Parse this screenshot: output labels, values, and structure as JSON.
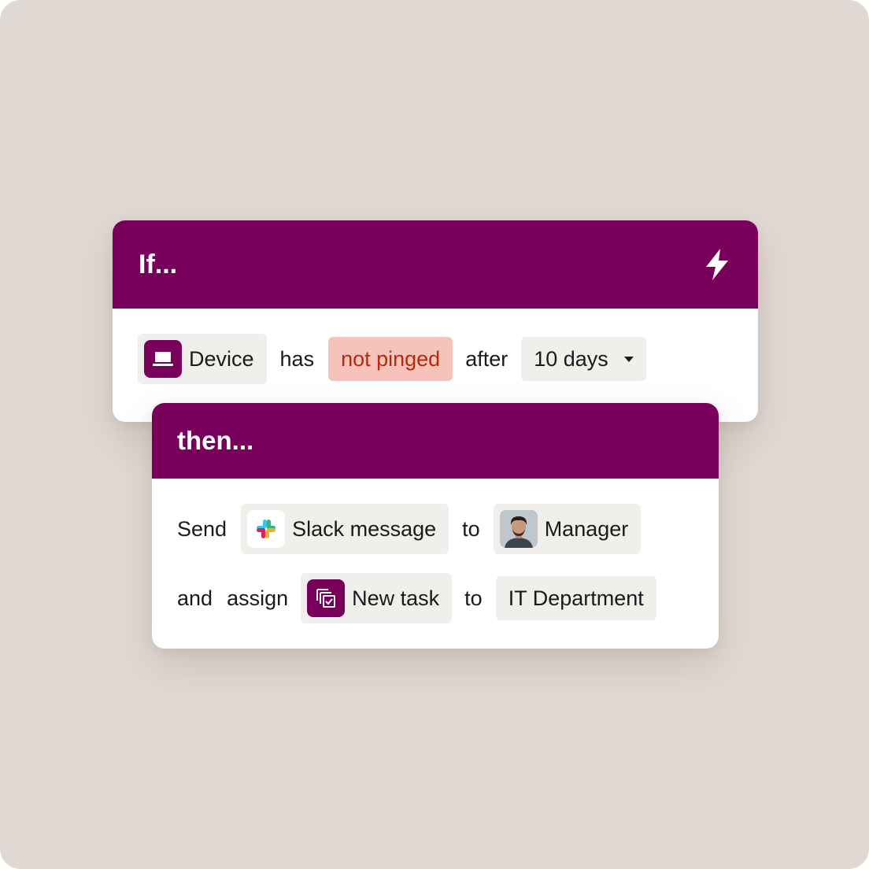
{
  "if_card": {
    "title": "If...",
    "condition": {
      "subject": "Device",
      "verb": "has",
      "state": "not pinged",
      "connector": "after",
      "duration": "10 days"
    }
  },
  "then_card": {
    "title": "then...",
    "action_1": {
      "verb": "Send",
      "item": "Slack message",
      "connector": "to",
      "recipient": "Manager"
    },
    "action_2": {
      "conjunction": "and",
      "verb": "assign",
      "item": "New task",
      "connector": "to",
      "recipient": "IT Department"
    }
  },
  "icons": {
    "trigger": "lightning-bolt-icon",
    "device": "laptop-icon",
    "slack": "slack-logo-icon",
    "manager": "person-avatar",
    "task": "task-checklist-icon",
    "dropdown": "caret-down-icon"
  },
  "colors": {
    "background": "#e1d9d3",
    "header": "#79005a",
    "chip": "#f1efec",
    "danger_chip": "#f6c3bb",
    "danger_text": "#b52a0d"
  }
}
